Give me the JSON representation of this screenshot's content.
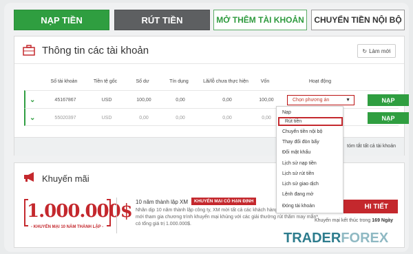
{
  "top_buttons": {
    "nap_tien": "NẠP TIỀN",
    "rut_tien": "RÚT TIỀN",
    "mo_them": "MỞ THÊM TÀI KHOẢN",
    "chuyen_tien": "CHUYỂN TIỀN NỘI BỘ"
  },
  "accounts": {
    "title": "Thông tin các tài khoản",
    "refresh_label": "Làm mới",
    "columns": [
      "Số tài khoản",
      "Tiền tệ gốc",
      "Số dư",
      "Tín dụng",
      "Lãi/lỗ chưa thực hiện",
      "Vốn",
      "Hoạt động"
    ],
    "rows": [
      {
        "account": "45167867",
        "currency": "USD",
        "balance": "100,00",
        "credit": "0,00",
        "pnl": "0,00",
        "equity": "100,00",
        "select": "Chọn phương án",
        "action": "NẠP"
      },
      {
        "account": "55020397",
        "currency": "USD",
        "balance": "0,00",
        "credit": "0,00",
        "pnl": "0,00",
        "equity": "0,00",
        "action": "NẠP"
      }
    ],
    "summary_link": "tóm tắt tất cả tài khoản"
  },
  "dropdown": {
    "items": [
      "Nạp",
      "Rút tiền",
      "Chuyển tiền nội bộ",
      "Thay đổi đòn bẩy",
      "Đổi mật khẩu",
      "Lịch sử nạp tiền",
      "Lịch sử rút tiền",
      "Lịch sử giao dịch",
      "Lệnh đang mở",
      "Đóng tài khoản"
    ],
    "selected": "Rút tiền"
  },
  "promo": {
    "title": "Khuyến mãi",
    "amount": "1.000.000$",
    "amount_sub": "- KHUYẾN MẠI 10 NĂM THÀNH LẬP -",
    "heading": "10 năm thành lập XM",
    "badge": "KHUYẾN MẠI CÓ HẠN ĐỊNH",
    "text": "Nhân dịp 10 năm thành lập công ty, XM mời tất cả các khách hàng mới và khách hàng mới tham gia chương trình khuyến mại khủng với các giải thưởng rút thăm may mắn* có tổng giá trị 1.000.000$.",
    "detail_button": "HI TIẾT",
    "ends_prefix": "Khuyến mại kết thúc trong",
    "ends_value": "169 Ngày"
  },
  "watermark": {
    "part1": "TRADER",
    "part2": "FOREX"
  },
  "colors": {
    "green": "#2f9e40",
    "red": "#c4282d",
    "gray_button": "#5d5f61"
  }
}
